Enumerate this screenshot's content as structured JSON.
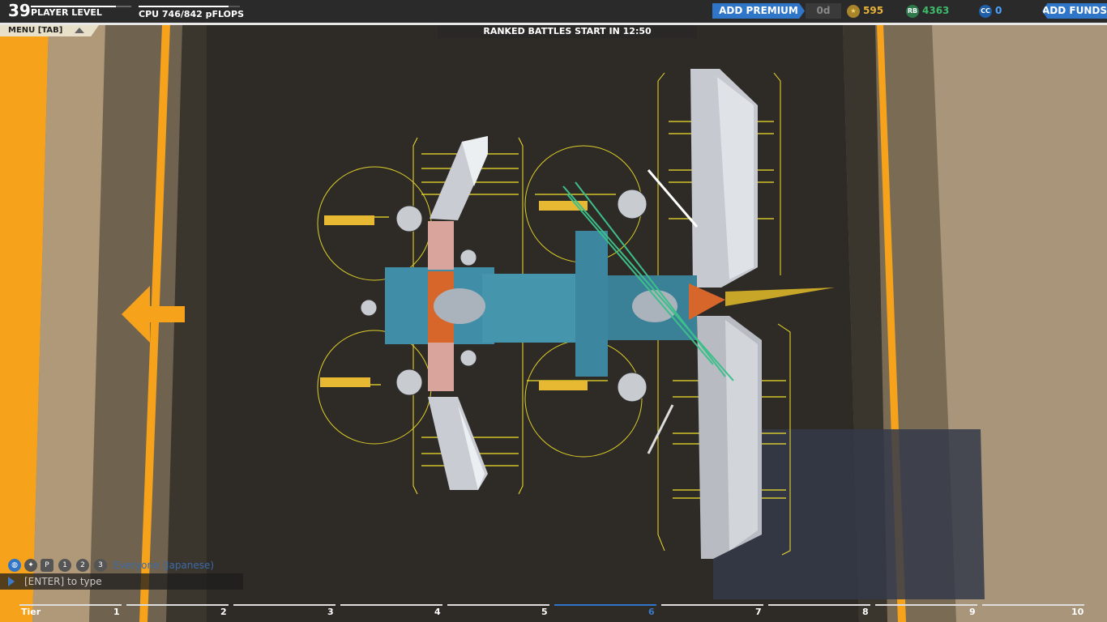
{
  "hud": {
    "player_level": "39",
    "player_level_label": "PLAYER LEVEL",
    "level_progress": 0.85,
    "cpu_label": "CPU 746/842 pFLOPS",
    "cpu_used": 746,
    "cpu_max": 842,
    "add_premium_label": "ADD PREMIUM",
    "premium_days": "0d",
    "tech_points": "595",
    "robits": "4363",
    "cosmetic_credits": "0",
    "add_funds_label": "ADD FUNDS"
  },
  "menu": {
    "label": "MENU [TAB]"
  },
  "notice": {
    "ranked": "RANKED BATTLES START IN 12:50"
  },
  "chat": {
    "channel": "Everyone (Japanese)",
    "input_placeholder": "[ENTER] to type",
    "icons": [
      "globe-icon",
      "accessibility-icon",
      "p-icon",
      "party-1-icon",
      "party-2-icon",
      "party-3-icon"
    ],
    "party_numbers": [
      "1",
      "2",
      "3"
    ]
  },
  "tiers": {
    "label": "Tier",
    "values": [
      "1",
      "2",
      "3",
      "4",
      "5",
      "6",
      "7",
      "8",
      "9",
      "10"
    ],
    "current": "6"
  },
  "colors": {
    "accent_blue": "#2f76c8",
    "road_orange": "#f7a21b",
    "robits_green": "#3dba6a",
    "tech_gold": "#e8b23a"
  }
}
